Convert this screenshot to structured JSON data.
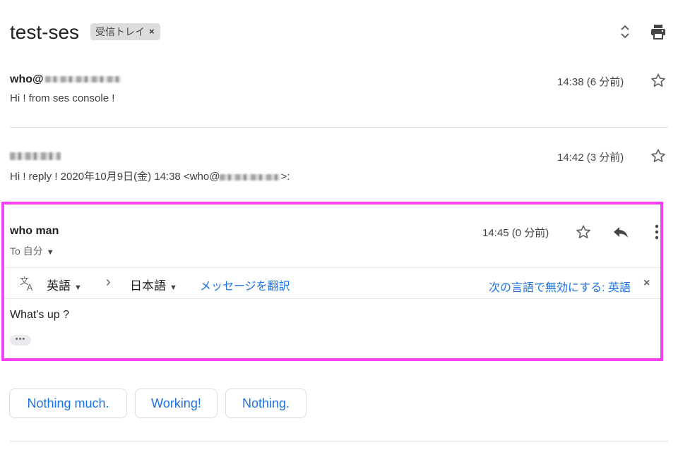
{
  "thread": {
    "subject": "test-ses",
    "label": "受信トレイ",
    "label_remove": "×"
  },
  "toolbar": {
    "expand_icon": "unfold-icon",
    "print_icon": "print-icon"
  },
  "messages": [
    {
      "sender": "who@",
      "snippet": "Hi ! from ses console !",
      "time": "14:38 (6 分前)"
    },
    {
      "snippet_prefix": "Hi ! reply ! 2020年10月9日(金) 14:38 <who@",
      "snippet_suffix": ">:",
      "time": "14:42 (3 分前)"
    },
    {
      "sender": "who man",
      "recipient": "To 自分",
      "time": "14:45 (0 分前)",
      "body": "What's up ?",
      "more_dots": "•••"
    }
  ],
  "translate": {
    "source_lang": "英語",
    "arrow": "›",
    "target_lang": "日本語",
    "translate_link": "メッセージを翻訳",
    "disable_link": "次の言語で無効にする: 英語",
    "close": "×"
  },
  "smart_replies": [
    "Nothing much.",
    "Working!",
    "Nothing."
  ],
  "colors": {
    "accent": "#1a73e8",
    "highlight_border": "#f542f5",
    "chip_bg": "#dddddd"
  }
}
